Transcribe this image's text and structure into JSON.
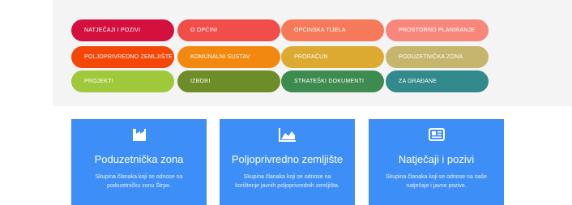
{
  "nav": {
    "items": [
      {
        "label": "NATJEČAJI I POZIVI",
        "color": "#d4103f"
      },
      {
        "label": "O OPĆINI",
        "color": "#f14d4a"
      },
      {
        "label": "OPĆINSKA TIJELA",
        "color": "#f6795a"
      },
      {
        "label": "PROSTORNO PLANIRANJE",
        "color": "#f7877b"
      },
      {
        "label": "POLJOPRIVREDNO ZEMLJIŠTE",
        "color": "#f44607"
      },
      {
        "label": "KOMUNALNI SUSTAV",
        "color": "#f2880f"
      },
      {
        "label": "PRORAČUN",
        "color": "#dcaa30"
      },
      {
        "label": "PODUZETNIČKA ZONA",
        "color": "#c6b56d"
      },
      {
        "label": "PROJEKTI",
        "color": "#9fc93a"
      },
      {
        "label": "IZBORI",
        "color": "#6e8d28"
      },
      {
        "label": "STRATEŠKI DOKUMENTI",
        "color": "#3e8b4f"
      },
      {
        "label": "ZA GRAĐANE",
        "color": "#328a8c"
      }
    ]
  },
  "cards": [
    {
      "icon": "factory-icon",
      "title": "Poduzetnička zona",
      "description": "Skupina članaka koji se odnose na poduzetničku zonu Štrpe."
    },
    {
      "icon": "area-chart-icon",
      "title": "Poljoprivredno zemljište",
      "description": "Skupina članaka koji se odnose na korištenje javnih poljoprivrednih zemljišta."
    },
    {
      "icon": "newspaper-icon",
      "title": "Natječaji i pozivi",
      "description": "Skupina članaka koji se odnose na naše natječaje i javne pozive."
    }
  ]
}
